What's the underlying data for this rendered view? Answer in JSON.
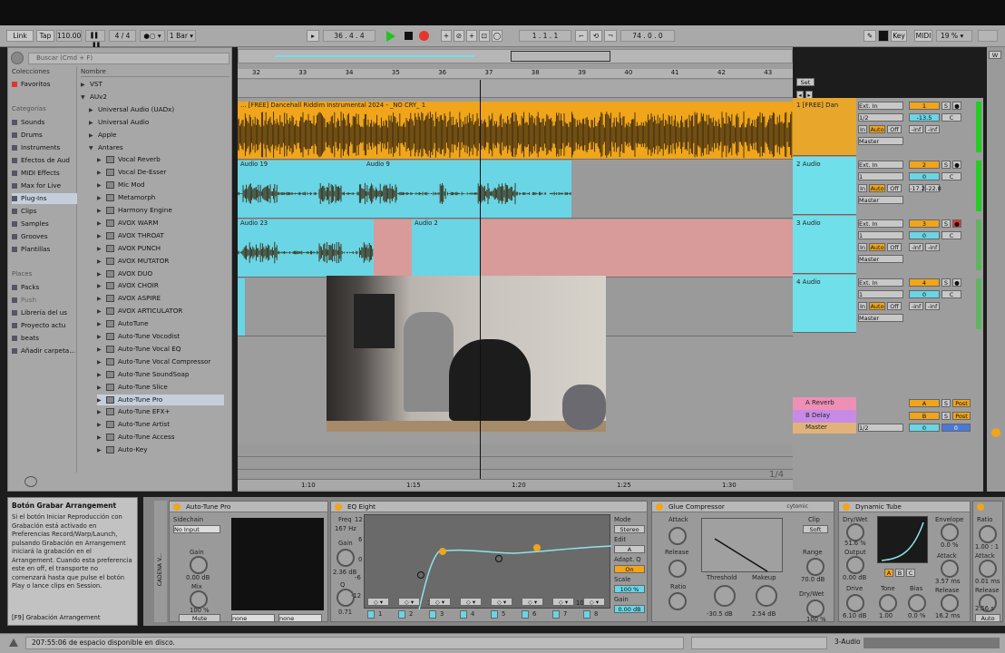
{
  "control_bar": {
    "link": "Link",
    "tap": "Tap",
    "tempo": "110.00",
    "signature": "4 / 4",
    "quantize": "1 Bar",
    "position": "36 . 4 . 4",
    "loop_start": "1 . 1 . 1",
    "loop_length": "74 . 0 . 0",
    "key": "Key",
    "midi": "MIDI",
    "cpu": "19 %"
  },
  "browser": {
    "search_placeholder": "Buscar (Cmd + F)",
    "col_collections": "Colecciones",
    "col_name": "Nombre",
    "favorites": "Favoritos",
    "categories_header": "Categorías",
    "categories": [
      "Sounds",
      "Drums",
      "Instruments",
      "Efectos de Aud",
      "MIDI Effects",
      "Max for Live",
      "Plug-Ins",
      "Clips",
      "Samples",
      "Grooves",
      "Plantillas"
    ],
    "places_header": "Places",
    "places": [
      "Packs",
      "Push",
      "Librería del us",
      "Proyecto actu",
      "beats",
      "Añadir carpeta..."
    ],
    "tree": [
      "VST",
      "AUv2",
      "Universal Audio (UADx)",
      "Universal Audio",
      "Apple",
      "Antares",
      "Vocal Reverb",
      "Vocal De-Esser",
      "Mic Mod",
      "Metamorph",
      "Harmony Engine",
      "AVOX WARM",
      "AVOX THROAT",
      "AVOX PUNCH",
      "AVOX MUTATOR",
      "AVOX DUO",
      "AVOX CHOIR",
      "AVOX ASPIRE",
      "AVOX ARTICULATOR",
      "AutoTune",
      "Auto-Tune Vocodist",
      "Auto-Tune Vocal EQ",
      "Auto-Tune Vocal Compressor",
      "Auto-Tune SoundSoap",
      "Auto-Tune Slice",
      "Auto-Tune Pro",
      "Auto-Tune EFX+",
      "Auto-Tune Artist",
      "Auto-Tune Access",
      "Auto-Key"
    ]
  },
  "ruler": {
    "bars": [
      "32",
      "33",
      "34",
      "35",
      "36",
      "37",
      "38",
      "39",
      "40",
      "41",
      "42",
      "43"
    ],
    "times": [
      "1:10",
      "1:15",
      "1:20",
      "1:25",
      "1:30"
    ],
    "set": "Set",
    "zoom": "1/4"
  },
  "clips": {
    "t1": "... [FREE] Dancehall Riddim Instrumental 2024 - _NO CRY_ 1",
    "t2a": "Audio 19",
    "t2b": "Audio 9",
    "t3a": "Audio 23",
    "t3b": "Audio 2"
  },
  "tracks": [
    {
      "name": "1 [FREE] Dan",
      "num": "1",
      "color": "#e8a62a",
      "input": "Ext. In",
      "ch": "1/2",
      "vol": "-13.5",
      "pan": "C",
      "out": "Master",
      "peak1": "-inf",
      "peak2": "-inf"
    },
    {
      "name": "2 Audio",
      "num": "2",
      "color": "#6fe0ea",
      "input": "Ext. In",
      "ch": "1",
      "vol": "0",
      "pan": "C",
      "out": "Master",
      "peak1": "-17.2",
      "peak2": "-22.8"
    },
    {
      "name": "3 Audio",
      "num": "3",
      "color": "#6fe0ea",
      "input": "Ext. In",
      "ch": "1",
      "vol": "0",
      "pan": "C",
      "out": "Master",
      "peak1": "-inf",
      "peak2": "-inf"
    },
    {
      "name": "4 Audio",
      "num": "4",
      "color": "#6fe0ea",
      "input": "Ext. In",
      "ch": "1",
      "vol": "0",
      "pan": "C",
      "out": "Master",
      "peak1": "-inf",
      "peak2": "-inf"
    }
  ],
  "returns": [
    {
      "name": "A Reverb",
      "letter": "A"
    },
    {
      "name": "B Delay",
      "letter": "B"
    }
  ],
  "master": {
    "name": "Master",
    "ch": "1/2",
    "vol": "0",
    "pan": "0"
  },
  "btn": {
    "in": "In",
    "auto": "Auto",
    "off": "Off",
    "s": "S",
    "post": "Post"
  },
  "info": {
    "title": "Botón Grabar Arrangement",
    "body": "Si el botón Iniciar Reproducción con Grabación está activado en Preferencias Record/Warp/Launch, pulsando Grabación en Arrangement iniciará la grabación en el Arrangement. Cuando esta preferencia este en off, el transporte no comenzará hasta que pulse el botón Play o lance clips en Session.",
    "footer": "[F9] Grabación Arrangement"
  },
  "chain_label": "CADENA V...",
  "autotune": {
    "title": "Auto-Tune Pro",
    "sidechain": "Sidechain",
    "input": "No Input",
    "gain": "Gain",
    "gain_val": "0.00 dB",
    "mix": "Mix",
    "mix_val": "100 %",
    "mute": "Mute",
    "none1": "none",
    "none2": "none"
  },
  "eq": {
    "title": "EQ Eight",
    "freq": "Freq",
    "freq_val": "167 Hz",
    "gain": "Gain",
    "gain_val": "2.36 dB",
    "q": "Q",
    "q_val": "0.71",
    "mode": "Mode",
    "mode_val": "Stereo",
    "edit": "Edit",
    "edit_val": "A",
    "adapt": "Adapt. Q",
    "on": "On",
    "scale": "Scale",
    "scale_val": "100 %",
    "gain2": "Gain",
    "gain2_val": "0.00 dB",
    "y_ticks": [
      "12",
      "6",
      "0",
      "-6",
      "-12"
    ],
    "x_ticks": [
      "100",
      "1k",
      "10k"
    ],
    "bands": [
      "1",
      "2",
      "3",
      "4",
      "5",
      "6",
      "7",
      "8"
    ]
  },
  "glue": {
    "title": "Glue Compressor",
    "brand": "cytomic",
    "attack": "Attack",
    "release": "Release",
    "ratio": "Ratio",
    "threshold": "Threshold",
    "threshold_val": "-30.5 dB",
    "makeup": "Makeup",
    "makeup_val": "2.54 dB",
    "clip": "Clip",
    "soft": "Soft",
    "range": "Range",
    "range_val": "70.0 dB",
    "drywet": "Dry/Wet",
    "drywet_val": "100 %",
    "meter_ticks": [
      "0",
      "5",
      "10",
      "15",
      "20"
    ],
    "attack_ticks": [
      ".01",
      ".1",
      "1",
      "3",
      "10",
      "30"
    ],
    "release_ticks": [
      ".2",
      ".4",
      ".6",
      "1.2",
      "A"
    ],
    "ratio_ticks": [
      "2",
      "4",
      "10"
    ]
  },
  "tube": {
    "title": "Dynamic Tube",
    "drywet": "Dry/Wet",
    "drywet_val": "51.6 %",
    "output": "Output",
    "output_val": "0.00 dB",
    "drive": "Drive",
    "drive_val": "6.10 dB",
    "tone": "Tone",
    "tone_val": "1.00",
    "bias": "Bias",
    "bias_val": "0.0 %",
    "envelope": "Envelope",
    "envelope_val": "0.0 %",
    "attack": "Attack",
    "attack_val": "3.57 ms",
    "release": "Release",
    "release_val": "16.2 ms",
    "abc": [
      "A",
      "B",
      "C"
    ]
  },
  "next_dev": {
    "ratio": "Ratio",
    "r_val": "1.00 : 1",
    "attack": "Attack",
    "a_val": "0.01 ms",
    "release": "Release",
    "rel_val": "2.56 s",
    "auto": "Auto"
  },
  "status": {
    "text": "207:55:06 de espacio disponible en disco.",
    "track": "3-Audio"
  }
}
